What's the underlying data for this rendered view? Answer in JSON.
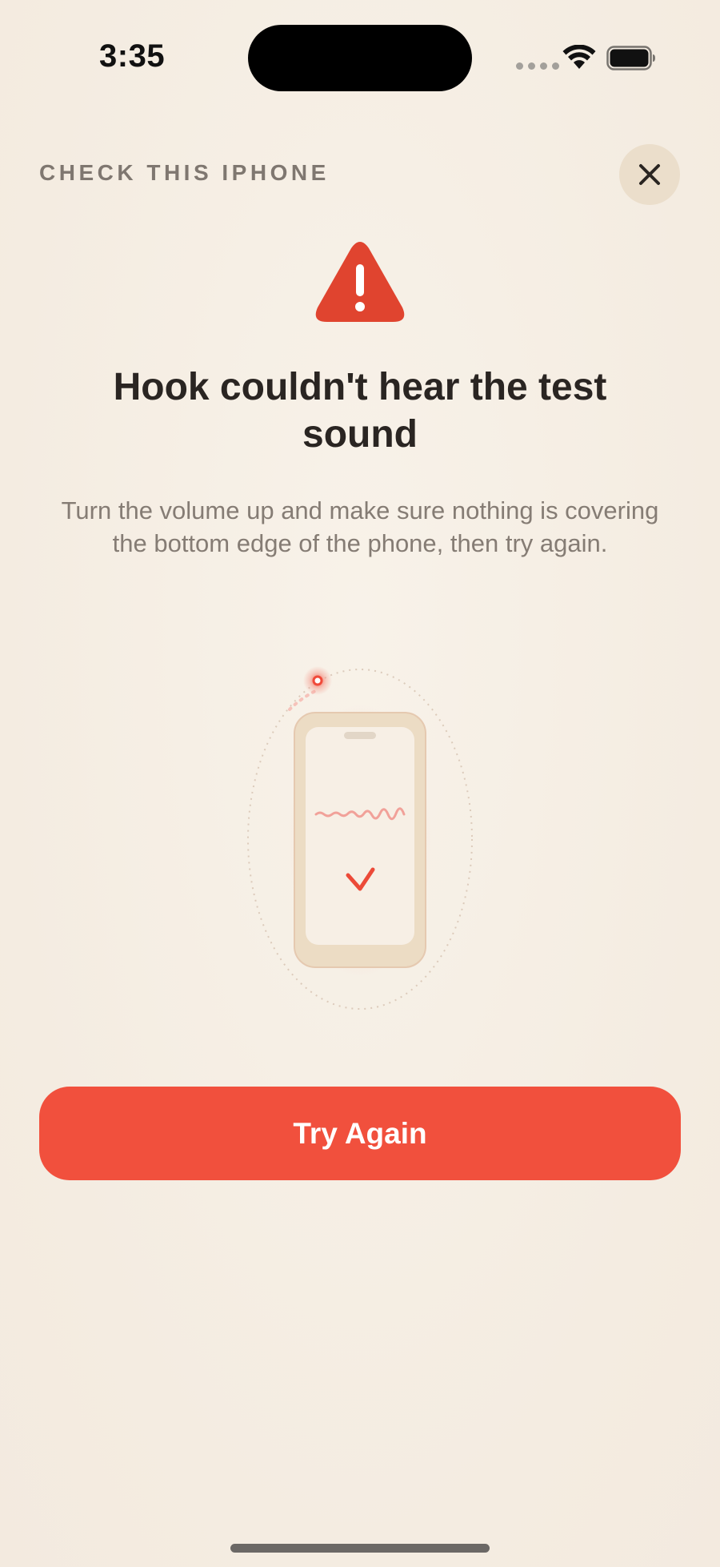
{
  "status_bar": {
    "time": "3:35"
  },
  "header": {
    "eyebrow": "CHECK THIS IPHONE",
    "close_icon": "close-icon"
  },
  "alert": {
    "icon": "warning-triangle-icon",
    "title": "Hook couldn't hear the test sound",
    "body": "Turn the volume up and make sure nothing is covering the bottom edge of the phone, then try again."
  },
  "illustration": {
    "description_icons": [
      "phone-icon",
      "sound-wave-icon",
      "checkmark-icon",
      "speaker-dot-icon"
    ]
  },
  "actions": {
    "primary_label": "Try Again"
  },
  "colors": {
    "background": "#f6efe5",
    "accent": "#f1503d",
    "warning": "#e0442f",
    "title": "#2a2522",
    "body": "#857c74",
    "close_bg": "#ebdecb"
  }
}
